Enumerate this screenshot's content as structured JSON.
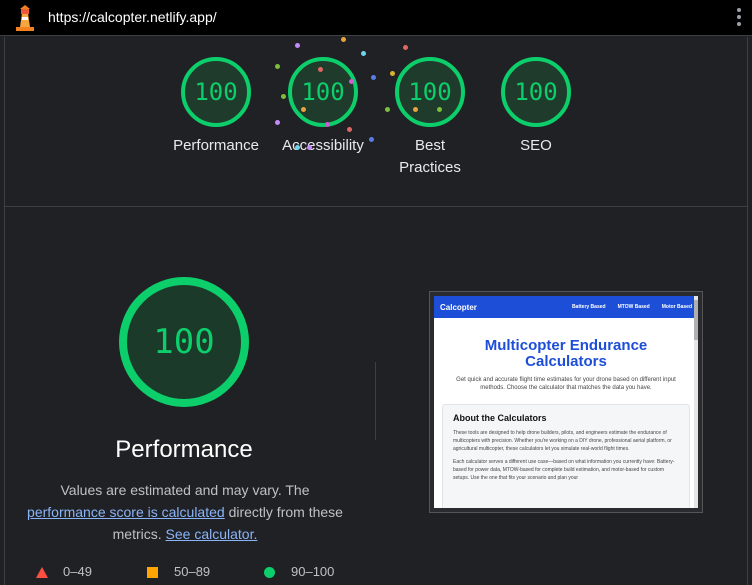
{
  "topbar": {
    "url": "https://calcopter.netlify.app/",
    "logo_icon": "lighthouse-icon",
    "menu_icon": "kebab-menu-icon"
  },
  "summary": {
    "gauges": [
      {
        "score": "100",
        "label": "Performance"
      },
      {
        "score": "100",
        "label": "Accessibility"
      },
      {
        "score": "100",
        "label": "Best Practices"
      },
      {
        "score": "100",
        "label": "SEO"
      }
    ]
  },
  "performance": {
    "score": "100",
    "title": "Performance",
    "desc_part1": "Values are estimated and may vary. The ",
    "link1": "performance score is calculated",
    "desc_part2": " directly from these metrics. ",
    "link2": "See calculator."
  },
  "legend": {
    "fail": "0–49",
    "average": "50–89",
    "pass": "90–100"
  },
  "screenshot": {
    "brand": "Calcopter",
    "nav": [
      "Battery Based",
      "MTOW Based",
      "Motor Based"
    ],
    "hero_title": "Multicopter Endurance Calculators",
    "hero_sub": "Get quick and accurate flight time estimates for your drone based on different input methods. Choose the calculator that matches the data you have.",
    "card_title": "About the Calculators",
    "card_p1": "These tools are designed to help drone builders, pilots, and engineers estimate the endurance of multicopters with precision. Whether you're working on a DIY drone, professional aerial platform, or agricultural multicopter, these calculators let you simulate real-world flight times.",
    "card_p2": "Each calculator serves a different use case—based on what information you currently have: Battery-based for power data, MTOW-based for complete build estimation, and motor-based for custom setups. Use the one that fits your scenario and plan your"
  },
  "colors": {
    "pass": "#0cce6b",
    "average": "#ffa400",
    "fail": "#ff4e42",
    "link": "#8ab4f8",
    "brand_blue": "#1d4ed8"
  }
}
